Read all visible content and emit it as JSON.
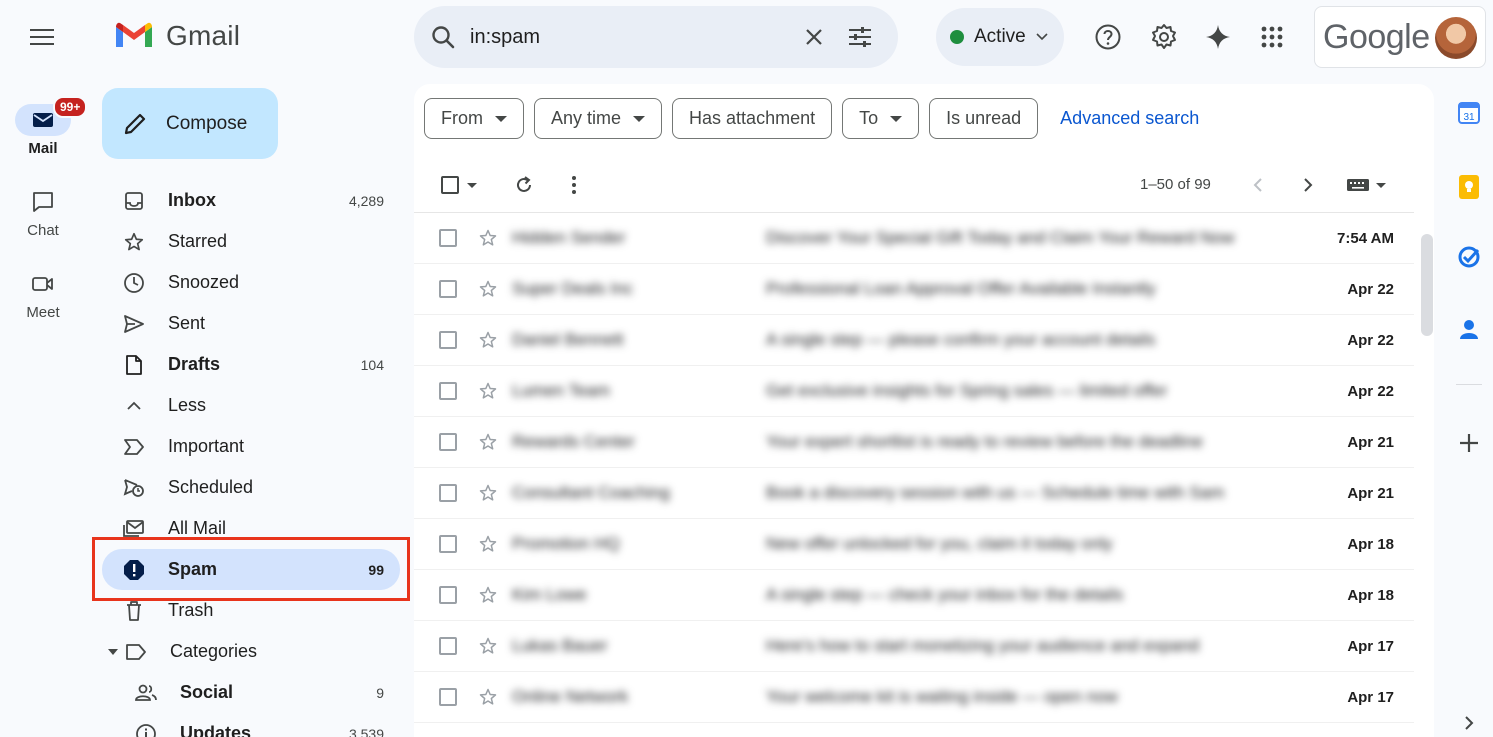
{
  "app": {
    "logo_text": "Gmail",
    "google_text": "Google"
  },
  "rail": {
    "items": [
      {
        "label": "Mail",
        "badge": "99+"
      },
      {
        "label": "Chat"
      },
      {
        "label": "Meet"
      }
    ]
  },
  "compose": {
    "label": "Compose"
  },
  "nav": {
    "items": [
      {
        "label": "Inbox",
        "count": "4,289"
      },
      {
        "label": "Starred",
        "count": ""
      },
      {
        "label": "Snoozed",
        "count": ""
      },
      {
        "label": "Sent",
        "count": ""
      },
      {
        "label": "Drafts",
        "count": "104"
      },
      {
        "label": "Less",
        "count": ""
      },
      {
        "label": "Important",
        "count": ""
      },
      {
        "label": "Scheduled",
        "count": ""
      },
      {
        "label": "All Mail",
        "count": ""
      },
      {
        "label": "Spam",
        "count": "99"
      },
      {
        "label": "Trash",
        "count": ""
      },
      {
        "label": "Categories",
        "count": ""
      },
      {
        "label": "Social",
        "count": "9"
      },
      {
        "label": "Updates",
        "count": "3,539"
      }
    ]
  },
  "search": {
    "value": "in:spam"
  },
  "status": {
    "label": "Active",
    "color": "#1e8e3e"
  },
  "filters": {
    "chips": [
      "From",
      "Any time",
      "Has attachment",
      "To",
      "Is unread"
    ],
    "advanced": "Advanced search"
  },
  "toolbar": {
    "pager": "1–50 of 99"
  },
  "emails": [
    {
      "sender": "Hidden Sender",
      "subject": "Discover Your Special Gift Today and Claim Your Reward Now",
      "date": "7:54 AM"
    },
    {
      "sender": "Super Deals Inc",
      "subject": "Professional Loan Approval Offer Available Instantly",
      "date": "Apr 22"
    },
    {
      "sender": "Daniel Bennett",
      "subject": "A single step — please confirm your account details",
      "date": "Apr 22"
    },
    {
      "sender": "Lumen Team",
      "subject": "Get exclusive insights for Spring sales — limited offer",
      "date": "Apr 22"
    },
    {
      "sender": "Rewards Center",
      "subject": "Your expert shortlist is ready to review before the deadline",
      "date": "Apr 21"
    },
    {
      "sender": "Consultant Coaching",
      "subject": "Book a discovery session with us — Schedule time with Sam",
      "date": "Apr 21"
    },
    {
      "sender": "Promotion HQ",
      "subject": "New offer unlocked for you, claim it today only",
      "date": "Apr 18"
    },
    {
      "sender": "Kim Lowe",
      "subject": "A single step — check your inbox for the details",
      "date": "Apr 18"
    },
    {
      "sender": "Lukas Bauer",
      "subject": "Here's how to start monetizing your audience and expand",
      "date": "Apr 17"
    },
    {
      "sender": "Online Network",
      "subject": "Your welcome kit is waiting inside — open now",
      "date": "Apr 17"
    }
  ],
  "colors": {
    "accent": "#0b57d0",
    "compose_bg": "#c2e7ff",
    "active_nav_bg": "#d3e3fd",
    "highlight_border": "#e8341c"
  }
}
